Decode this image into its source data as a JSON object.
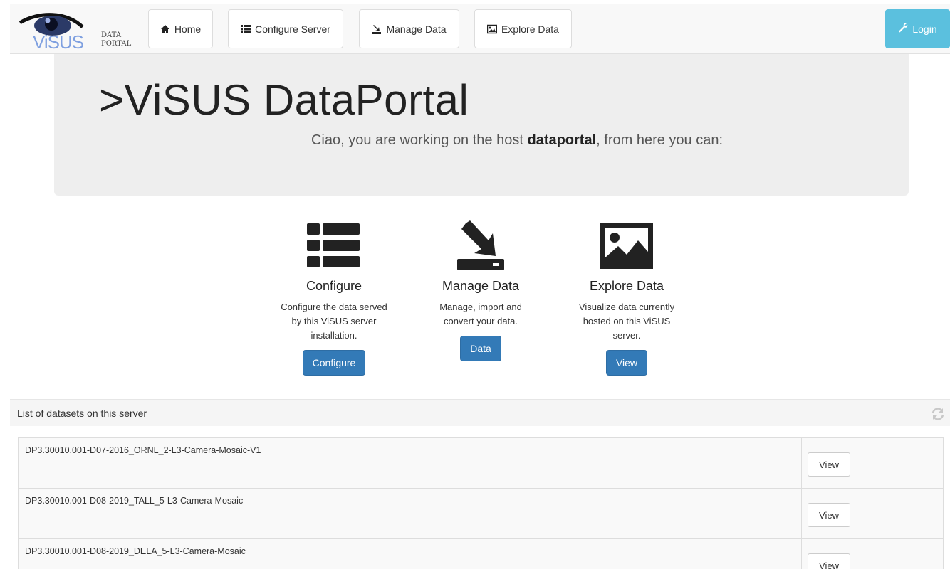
{
  "nav": {
    "logo_main": "ViSUS",
    "logo_sub1": "DATA",
    "logo_sub2": "PORTAL",
    "home": "Home",
    "configure_server": "Configure Server",
    "manage_data": "Manage Data",
    "explore_data": "Explore Data",
    "login": "Login"
  },
  "jumbotron": {
    "title": ">ViSUS DataPortal",
    "sub_prefix": "Ciao, you are working on the host ",
    "host": "dataportal",
    "sub_suffix": ", from here you can:"
  },
  "features": [
    {
      "icon": "list-icon",
      "title": "Configure",
      "lines": [
        "Configure the data served",
        "by this ViSUS server",
        "installation."
      ],
      "button": "Configure"
    },
    {
      "icon": "import-icon",
      "title": "Manage Data",
      "lines": [
        "Manage, import and",
        "convert your data."
      ],
      "button": "Data"
    },
    {
      "icon": "picture-icon",
      "title": "Explore Data",
      "lines": [
        "Visualize data currently",
        "hosted on this ViSUS",
        "server."
      ],
      "button": "View"
    }
  ],
  "datasets_panel": {
    "title": "List of datasets on this server",
    "rows": [
      {
        "name": "DP3.30010.001-D07-2016_ORNL_2-L3-Camera-Mosaic-V1",
        "action": "View"
      },
      {
        "name": "DP3.30010.001-D08-2019_TALL_5-L3-Camera-Mosaic",
        "action": "View"
      },
      {
        "name": "DP3.30010.001-D08-2019_DELA_5-L3-Camera-Mosaic",
        "action": "View"
      }
    ]
  },
  "colors": {
    "primary": "#337ab7",
    "info": "#5bc0de",
    "jumbotron_bg": "#eeeeee"
  }
}
